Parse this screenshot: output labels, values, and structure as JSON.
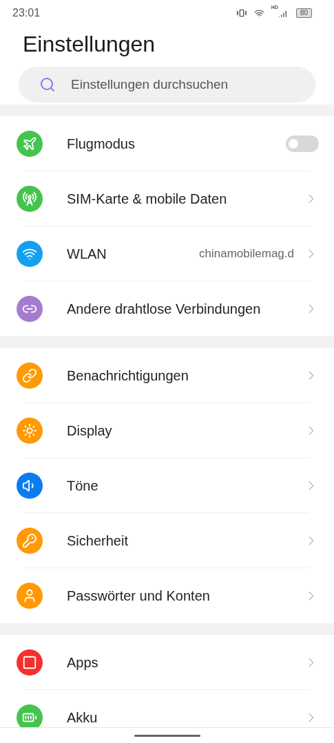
{
  "status_bar": {
    "time": "23:01",
    "network": "HD",
    "battery": "80"
  },
  "title": "Einstellungen",
  "search": {
    "placeholder": "Einstellungen durchsuchen"
  },
  "groups": [
    {
      "items": [
        {
          "kind": "toggle",
          "label": "Flugmodus",
          "color": "#44c44c",
          "on": false
        },
        {
          "kind": "link",
          "label": "SIM-Karte & mobile Daten",
          "color": "#44c44c"
        },
        {
          "kind": "link",
          "label": "WLAN",
          "value": "chinamobilemag.d",
          "color": "#14a0ee"
        },
        {
          "kind": "link",
          "label": "Andere drahtlose Verbindungen",
          "color": "#a77bd0"
        }
      ]
    },
    {
      "items": [
        {
          "kind": "link",
          "label": "Benachrichtigungen",
          "color": "#ff9a05"
        },
        {
          "kind": "link",
          "label": "Display",
          "color": "#ff9a05"
        },
        {
          "kind": "link",
          "label": "Töne",
          "color": "#0a7cf0"
        },
        {
          "kind": "link",
          "label": "Sicherheit",
          "color": "#ff9a05"
        },
        {
          "kind": "link",
          "label": "Passwörter und Konten",
          "color": "#ff9a05"
        }
      ]
    },
    {
      "items": [
        {
          "kind": "link",
          "label": "Apps",
          "color": "#f6302f"
        },
        {
          "kind": "link",
          "label": "Akku",
          "color": "#44c44c"
        }
      ]
    }
  ]
}
